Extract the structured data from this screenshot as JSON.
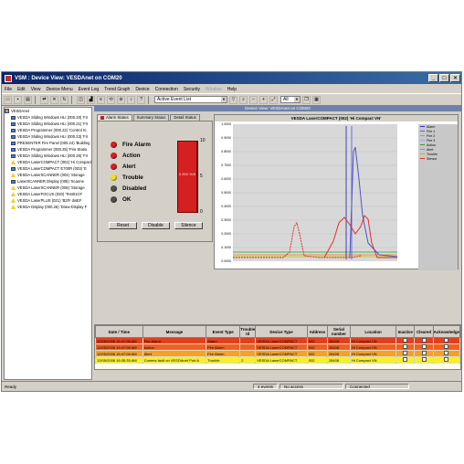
{
  "window": {
    "title": "VSM : Device View: VESDAnet on COM20"
  },
  "menu": [
    "File",
    "Edit",
    "View",
    "Device Menu",
    "Event Log",
    "Trend Graph",
    "Device",
    "Connection",
    "Security",
    "Window",
    "Help"
  ],
  "menu_disabled": [
    9
  ],
  "toolbar": {
    "event_list": "Active Event List",
    "zoom": "All"
  },
  "tree": {
    "root": "VESDAnet",
    "items": [
      {
        "label": "VESDA Sliding Windows HLI (000.20) 'Fir",
        "icon": "device"
      },
      {
        "label": "VESDA Sliding Windows HLI (000.21) 'Fir",
        "icon": "device"
      },
      {
        "label": "VESDA Programmer (000.22) 'Control ro",
        "icon": "device"
      },
      {
        "label": "VESDA Sliding Windows HLI (000.23) 'Fir",
        "icon": "device"
      },
      {
        "label": "PRESENTER Fire Panel (000.24) 'Building",
        "icon": "device"
      },
      {
        "label": "VESDA Programmer (000.25) 'Fire Statio",
        "icon": "device"
      },
      {
        "label": "VESDA Sliding Windows HLI (000.26) 'Fir",
        "icon": "device"
      },
      {
        "label": "VESDA LaserCOMPACT (002) 'Hi Compact",
        "icon": "warn"
      },
      {
        "label": "VESDA LaserCOMPACT E700R (003) 'E",
        "icon": "device"
      },
      {
        "label": "VESDA LaserSCANNER (004) 'Storage",
        "icon": "warn"
      },
      {
        "label": "LaserSCANNER Display (005) 'Scanne",
        "icon": "device"
      },
      {
        "label": "VESDA LaserSCANNER (006) 'Storage",
        "icon": "warn"
      },
      {
        "label": "VESDA LaserFOCUS (020) 'Test01CF",
        "icon": "warn"
      },
      {
        "label": "VESDA LaserPLUS (021) 'B2Fr disEF",
        "icon": "warn"
      },
      {
        "label": "VESDA Display (000.26) 'Draw-Display F",
        "icon": "warn"
      }
    ]
  },
  "device_view": {
    "header": "Device View: VESDAnet on COM20"
  },
  "tabs": [
    "Alarm Status",
    "Summary Status",
    "Detail Status"
  ],
  "alarm": {
    "levels": [
      {
        "label": "Fire Alarm",
        "color": "#d42020"
      },
      {
        "label": "Action",
        "color": "#d42020"
      },
      {
        "label": "Alert",
        "color": "#d42020"
      },
      {
        "label": "Trouble",
        "color": "#f0e020"
      },
      {
        "label": "Disabled",
        "color": "#505050"
      },
      {
        "label": "OK",
        "color": "#505050"
      }
    ],
    "bar_label": "0.500 %/ft",
    "bar_fill": 1.0,
    "scale": [
      "10",
      "5",
      "0"
    ],
    "buttons": [
      "Reset",
      "Disable",
      "Silence"
    ]
  },
  "chart": {
    "title": "VESDA LaserCOMPACT (002) 'Hi Compact VN'",
    "yticks": [
      "1.0000",
      "0.9000",
      "0.8000",
      "0.7000",
      "0.6000",
      "0.5000",
      "0.4000",
      "0.3000",
      "0.2000",
      "0.1000",
      "0.0000"
    ],
    "legend": [
      {
        "label": "Alarm",
        "color": "#3030c0"
      },
      {
        "label": "Fire 1",
        "color": "#6060e0"
      },
      {
        "label": "Fire 2",
        "color": "#9090f0"
      },
      {
        "label": "Fire 3",
        "color": "#a0a0ff"
      },
      {
        "label": "Action",
        "color": "#30a030"
      },
      {
        "label": "Alert",
        "color": "#e08030"
      },
      {
        "label": "Trouble",
        "color": "#c0c000"
      },
      {
        "label": "Sensor",
        "color": "#e03030"
      }
    ]
  },
  "events": {
    "columns": [
      "Date / Time",
      "Message",
      "Event Type",
      "Trouble Id",
      "Device Type",
      "Address",
      "Serial number",
      "Location",
      "Inactive",
      "Cleared",
      "Acknowledge"
    ],
    "rows": [
      {
        "color": "#e04020",
        "cells": [
          "12/05/2006 16:47:08 AM",
          "Fire Alarm",
          "Alarm",
          "",
          "VESDA LaserCOMPACT",
          "002",
          "28408",
          "Hi Compact VN"
        ]
      },
      {
        "color": "#f06020",
        "cells": [
          "12/05/2006 16:47:08 AM",
          "Action",
          "Fire Alarm",
          "",
          "VESDA LaserCOMPACT",
          "002",
          "28408",
          "Hi Compact VN"
        ]
      },
      {
        "color": "#f8a020",
        "cells": [
          "12/05/2006 16:47:08 AM",
          "Alert",
          "Fire Alarm",
          "",
          "VESDA LaserCOMPACT",
          "002",
          "28408",
          "Hi Compact VN"
        ]
      },
      {
        "color": "#f8f020",
        "cells": [
          "12/05/2006 16:35:35 AM",
          "Comms fault on VESDAnet Port A",
          "Trouble",
          "2",
          "VESDA LaserCOMPACT",
          "002",
          "28408",
          "Hi Compact VN"
        ]
      }
    ]
  },
  "statusbar": {
    "left": "Ready",
    "events": "4 events",
    "access": "No access",
    "conn": "Connected"
  }
}
